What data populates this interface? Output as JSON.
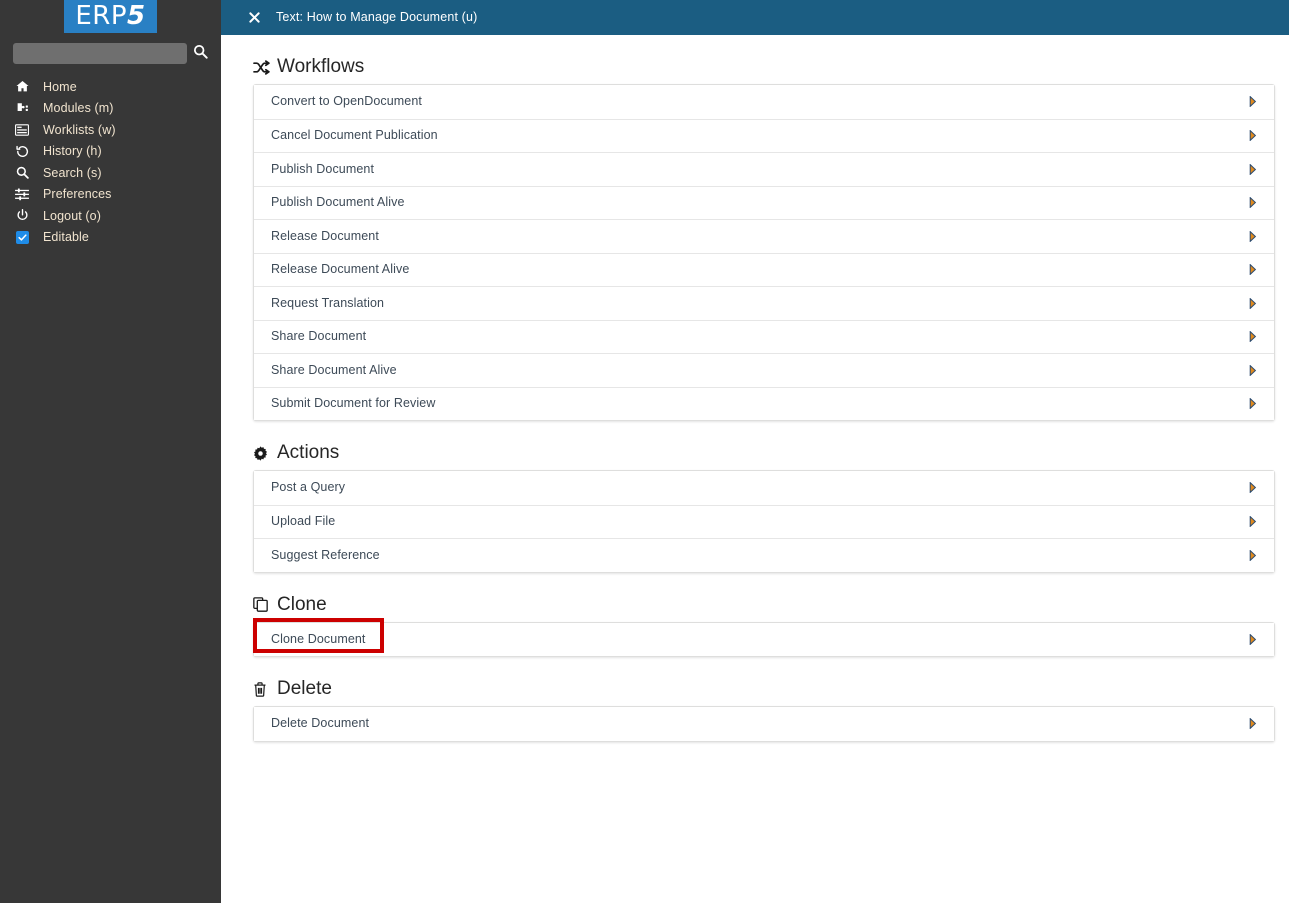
{
  "sidebar": {
    "logo": {
      "text_main": "ERP",
      "text_accent": "5"
    },
    "search": {
      "value": "",
      "placeholder": "",
      "button_icon": "search-icon"
    },
    "items": [
      {
        "label": "Home",
        "icon": "home-icon"
      },
      {
        "label": "Modules (m)",
        "icon": "modules-icon"
      },
      {
        "label": "Worklists (w)",
        "icon": "worklists-icon"
      },
      {
        "label": "History (h)",
        "icon": "history-icon"
      },
      {
        "label": "Search (s)",
        "icon": "search-icon"
      },
      {
        "label": "Preferences",
        "icon": "sliders-icon"
      },
      {
        "label": "Logout (o)",
        "icon": "power-icon"
      },
      {
        "label": "Editable",
        "icon": "checkbox-checked-icon"
      }
    ]
  },
  "header": {
    "close_icon": "close-icon",
    "title": "Text: How to Manage Document (u)"
  },
  "main": {
    "sections": [
      {
        "title": "Workflows",
        "icon": "shuffle-icon",
        "rows": [
          {
            "label": "Convert to OpenDocument"
          },
          {
            "label": "Cancel Document Publication"
          },
          {
            "label": "Publish Document"
          },
          {
            "label": "Publish Document Alive"
          },
          {
            "label": "Release Document"
          },
          {
            "label": "Release Document Alive"
          },
          {
            "label": "Request Translation"
          },
          {
            "label": "Share Document"
          },
          {
            "label": "Share Document Alive"
          },
          {
            "label": "Submit Document for Review"
          }
        ]
      },
      {
        "title": "Actions",
        "icon": "gear-icon",
        "rows": [
          {
            "label": "Post a Query"
          },
          {
            "label": "Upload File"
          },
          {
            "label": "Suggest Reference"
          }
        ]
      },
      {
        "title": "Clone",
        "icon": "copy-icon",
        "rows": [
          {
            "label": "Clone Document",
            "highlighted": true
          }
        ]
      },
      {
        "title": "Delete",
        "icon": "trash-icon",
        "rows": [
          {
            "label": "Delete Document"
          }
        ]
      }
    ]
  },
  "colors": {
    "sidebar_bg": "#373737",
    "logo_bg": "#2980c4",
    "header_bg": "#1b5d82",
    "nav_label": "#f1e4cf",
    "row_label": "#3d4a57",
    "highlight_border": "#cc0000",
    "checkbox_accent": "#1f8ce8",
    "row_arrow": "#e08a1e"
  }
}
